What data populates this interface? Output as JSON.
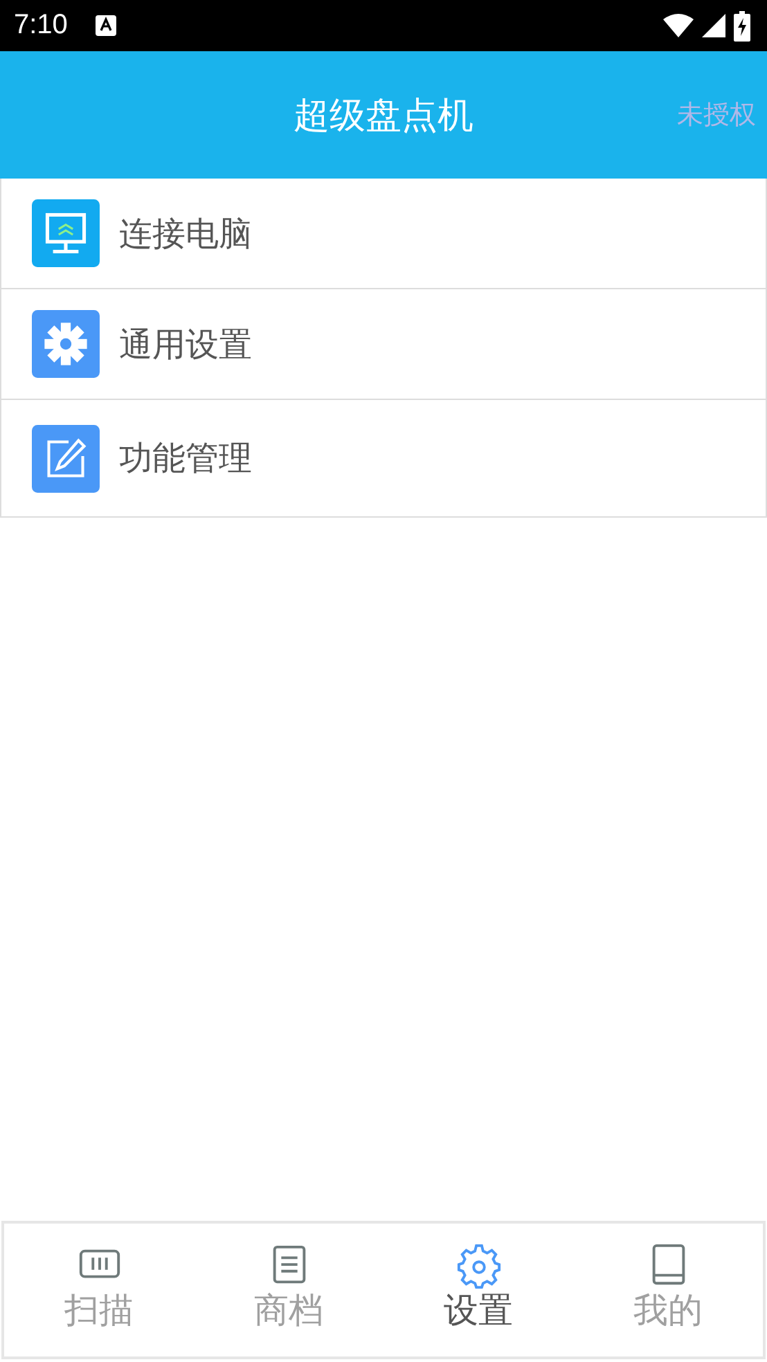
{
  "status_bar": {
    "time": "7:10"
  },
  "header": {
    "title": "超级盘点机",
    "action": "未授权"
  },
  "menu": [
    {
      "label": "连接电脑",
      "kind": "monitor"
    },
    {
      "label": "通用设置",
      "kind": "gear"
    },
    {
      "label": "功能管理",
      "kind": "edit"
    }
  ],
  "tabs": [
    {
      "label": "扫描",
      "kind": "scan",
      "selected": false
    },
    {
      "label": "商档",
      "kind": "list",
      "selected": false
    },
    {
      "label": "设置",
      "kind": "gear",
      "selected": true
    },
    {
      "label": "我的",
      "kind": "book",
      "selected": false
    }
  ]
}
